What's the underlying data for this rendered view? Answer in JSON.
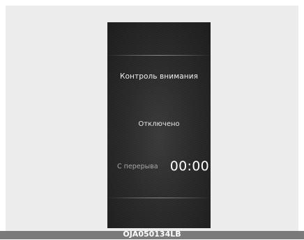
{
  "screen": {
    "title": "Контроль внимания",
    "status": "Отключено",
    "break_label": "С перерыва",
    "break_time": "00:00"
  },
  "figure": {
    "caption": "OJA050134LB"
  }
}
